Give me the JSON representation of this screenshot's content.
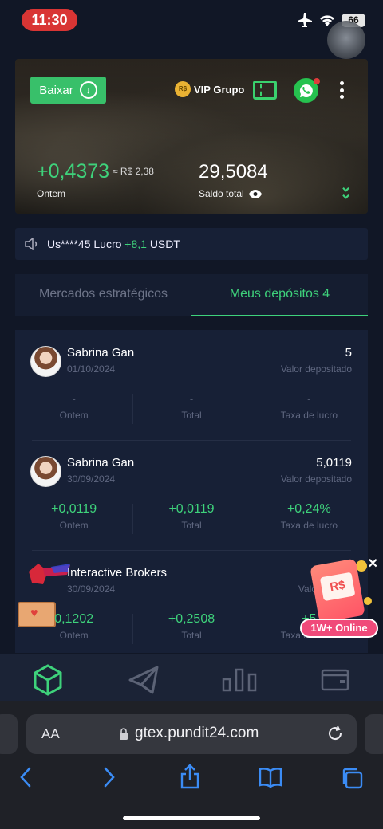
{
  "status_bar": {
    "time": "11:30",
    "battery": "66"
  },
  "hero": {
    "download_label": "Baixar",
    "coin_badge": "R$",
    "vip_label": "VIP Grupo",
    "profit_value": "+0,4373",
    "profit_brl": "≈ R$ 2,38",
    "profit_label": "Ontem",
    "balance_value": "29,5084",
    "balance_label": "Saldo total"
  },
  "notice": {
    "user": "Us****45 Lucro",
    "amount": "+8,1",
    "currency": "USDT"
  },
  "tabs": [
    {
      "label": "Mercados estratégicos",
      "active": false
    },
    {
      "label": "Meus depósitos 4",
      "active": true
    }
  ],
  "deposits": [
    {
      "name": "Sabrina Gan",
      "date": "01/10/2024",
      "amount": "5",
      "amount_label": "Valor depositado",
      "stats": [
        {
          "value": "-",
          "label": "Ontem"
        },
        {
          "value": "-",
          "label": "Total"
        },
        {
          "value": "-",
          "label": "Taxa de lucro"
        }
      ]
    },
    {
      "name": "Sabrina Gan",
      "date": "30/09/2024",
      "amount": "5,0119",
      "amount_label": "Valor depositado",
      "stats": [
        {
          "value": "+0,0119",
          "label": "Ontem"
        },
        {
          "value": "+0,0119",
          "label": "Total"
        },
        {
          "value": "+0,24%",
          "label": "Taxa de lucro"
        }
      ]
    },
    {
      "name": "Interactive Brokers",
      "date": "30/09/2024",
      "amount": "",
      "amount_label": "Valor",
      "stats": [
        {
          "value": "0,1202",
          "label": "Ontem"
        },
        {
          "value": "+0,2508",
          "label": "Total"
        },
        {
          "value": "+5",
          "label": "Taxa de lucro"
        }
      ]
    }
  ],
  "promo": {
    "card_text": "R$",
    "badge": "1W+ Online"
  },
  "browser": {
    "url": "gtex.pundit24.com",
    "aa_label": "AA"
  },
  "colors": {
    "accent_green": "#3ed27b",
    "background": "#111726",
    "card": "#172036",
    "recording_red": "#d93534"
  }
}
